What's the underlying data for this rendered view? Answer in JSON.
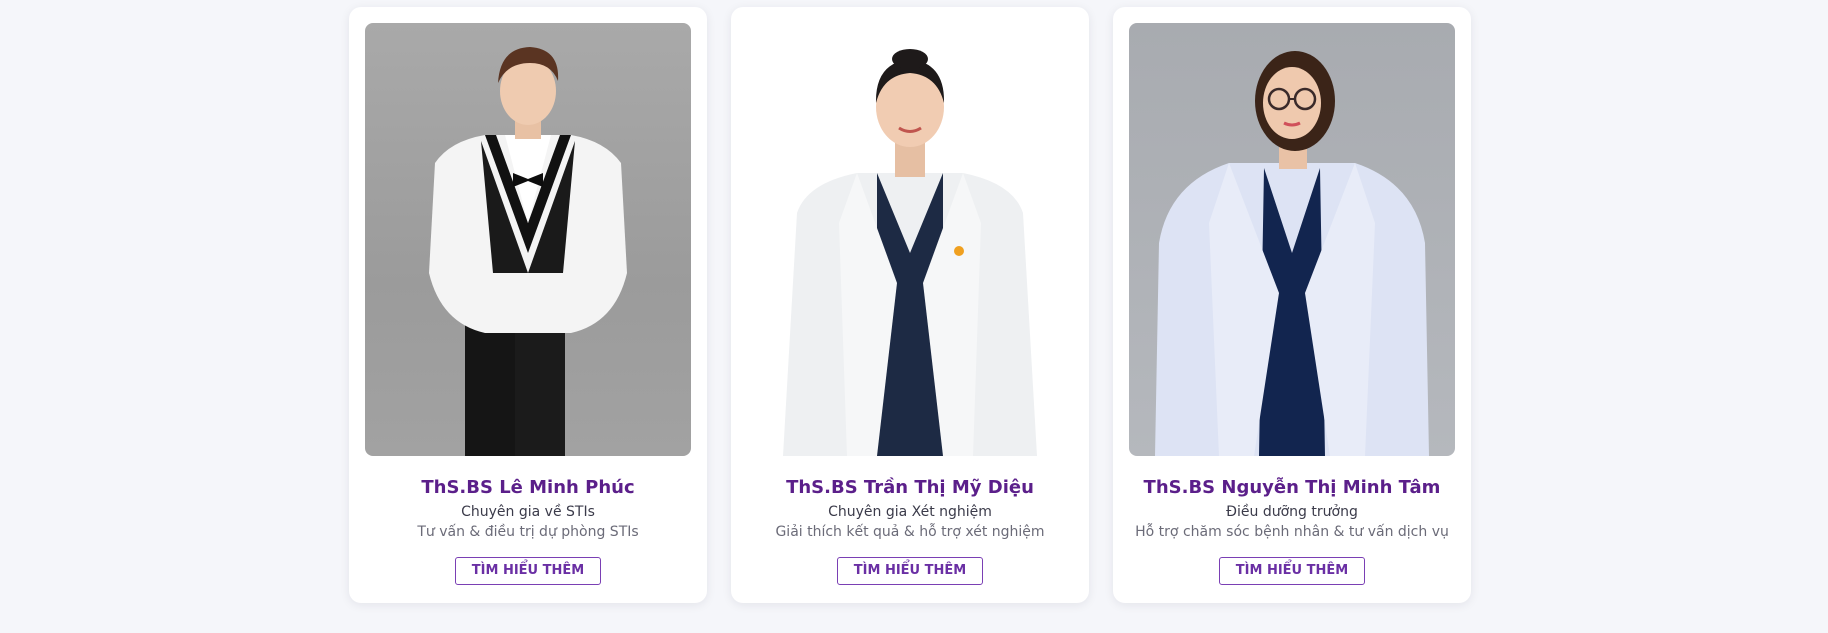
{
  "doctors": [
    {
      "name": "ThS.BS Lê Minh Phúc",
      "role": "Chuyên gia về STIs",
      "description": "Tư vấn & điều trị dự phòng STIs",
      "button_label": "TÌM HIỂU THÊM"
    },
    {
      "name": "ThS.BS Trần Thị Mỹ Diệu",
      "role": "Chuyên gia Xét nghiệm",
      "description": "Giải thích kết quả & hỗ trợ xét nghiệm",
      "button_label": "TÌM HIỂU THÊM"
    },
    {
      "name": "ThS.BS Nguyễn Thị Minh Tâm",
      "role": "Điều dưỡng trưởng",
      "description": "Hỗ trợ chăm sóc bệnh nhân & tư vấn dịch vụ",
      "button_label": "TÌM HIỂU THÊM"
    }
  ],
  "colors": {
    "accent": "#5b1f8a",
    "button_border": "#7a3fb4",
    "page_background": "#f5f6fa"
  }
}
